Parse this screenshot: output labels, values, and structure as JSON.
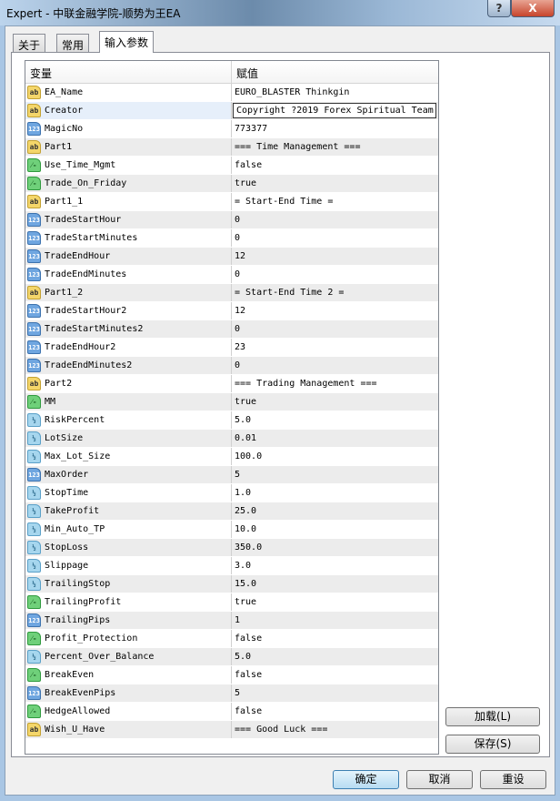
{
  "window": {
    "title": "Expert - 中联金融学院-顺势为王EA",
    "help": "?",
    "close": "X"
  },
  "tabs": [
    {
      "label": "关于"
    },
    {
      "label": "常用"
    },
    {
      "label": "输入参数"
    }
  ],
  "table": {
    "headers": [
      "变量",
      "赋值"
    ],
    "rows": [
      {
        "name": "EA_Name",
        "type": "string",
        "value": "EURO_BLASTER  Thinkgin"
      },
      {
        "name": "Creator",
        "type": "string",
        "value": "Copyright ?2019  Forex Spiritual Team"
      },
      {
        "name": "MagicNo",
        "type": "int",
        "value": "773377"
      },
      {
        "name": "Part1",
        "type": "string",
        "value": "=== Time Management ==="
      },
      {
        "name": "Use_Time_Mgmt",
        "type": "bool",
        "value": "false"
      },
      {
        "name": "Trade_On_Friday",
        "type": "bool",
        "value": "true"
      },
      {
        "name": "Part1_1",
        "type": "string",
        "value": "= Start-End Time ="
      },
      {
        "name": "TradeStartHour",
        "type": "int",
        "value": "0"
      },
      {
        "name": "TradeStartMinutes",
        "type": "int",
        "value": "0"
      },
      {
        "name": "TradeEndHour",
        "type": "int",
        "value": "12"
      },
      {
        "name": "TradeEndMinutes",
        "type": "int",
        "value": "0"
      },
      {
        "name": "Part1_2",
        "type": "string",
        "value": "= Start-End Time 2 ="
      },
      {
        "name": "TradeStartHour2",
        "type": "int",
        "value": "12"
      },
      {
        "name": "TradeStartMinutes2",
        "type": "int",
        "value": "0"
      },
      {
        "name": "TradeEndHour2",
        "type": "int",
        "value": "23"
      },
      {
        "name": "TradeEndMinutes2",
        "type": "int",
        "value": "0"
      },
      {
        "name": "Part2",
        "type": "string",
        "value": "=== Trading Management ==="
      },
      {
        "name": "MM",
        "type": "bool",
        "value": "true"
      },
      {
        "name": "RiskPercent",
        "type": "double",
        "value": "5.0"
      },
      {
        "name": "LotSize",
        "type": "double",
        "value": "0.01"
      },
      {
        "name": "Max_Lot_Size",
        "type": "double",
        "value": "100.0"
      },
      {
        "name": "MaxOrder",
        "type": "int",
        "value": "5"
      },
      {
        "name": "StopTime",
        "type": "double",
        "value": "1.0"
      },
      {
        "name": "TakeProfit",
        "type": "double",
        "value": "25.0"
      },
      {
        "name": "Min_Auto_TP",
        "type": "double",
        "value": "10.0"
      },
      {
        "name": "StopLoss",
        "type": "double",
        "value": "350.0"
      },
      {
        "name": "Slippage",
        "type": "double",
        "value": "3.0"
      },
      {
        "name": "TrailingStop",
        "type": "double",
        "value": "15.0"
      },
      {
        "name": "TrailingProfit",
        "type": "bool",
        "value": "true"
      },
      {
        "name": "TrailingPips",
        "type": "int",
        "value": "1"
      },
      {
        "name": "Profit_Protection",
        "type": "bool",
        "value": "false"
      },
      {
        "name": "Percent_Over_Balance",
        "type": "double",
        "value": "5.0"
      },
      {
        "name": "BreakEven",
        "type": "bool",
        "value": "false"
      },
      {
        "name": "BreakEvenPips",
        "type": "int",
        "value": "5"
      },
      {
        "name": "HedgeAllowed",
        "type": "bool",
        "value": "false"
      },
      {
        "name": "Wish_U_Have",
        "type": "string",
        "value": "=== Good Luck ==="
      }
    ]
  },
  "icons": {
    "string": "ab",
    "int": "123",
    "bool": "⁄-",
    "double": "½"
  },
  "buttons": {
    "load": "加载(L)",
    "save": "保存(S)",
    "ok": "确定",
    "cancel": "取消",
    "reset": "重设"
  }
}
